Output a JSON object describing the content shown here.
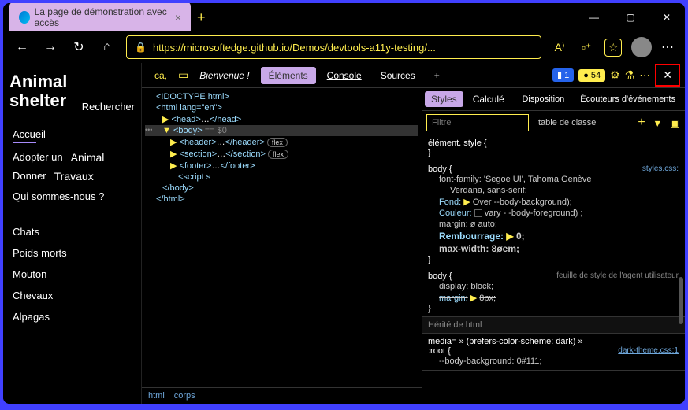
{
  "titlebar": {
    "tab_title": "La page de démonstration avec accès",
    "tab_close": "×",
    "new_tab": "+"
  },
  "addressbar": {
    "url": "https://microsoftedge.github.io/Demos/devtools-a11y-testing/..."
  },
  "page": {
    "title_line1": "Animal",
    "title_line2": "shelter",
    "search": "Rechercher",
    "nav": {
      "home": "Accueil",
      "adopt_a": "Adopter un",
      "adopt_b": "Animal",
      "donate_a": "Donner",
      "donate_b": "Travaux",
      "about": "Qui sommes-nous ?"
    },
    "animals": [
      "Chats",
      "Poids morts",
      "Mouton",
      "Chevaux",
      "Alpagas"
    ]
  },
  "devtools": {
    "tabs": {
      "ca": "ca,",
      "welcome": "Bienvenue !",
      "elements": "Éléments",
      "console": "Console",
      "sources": "Sources",
      "plus": "+"
    },
    "badges": {
      "issues": "1",
      "warnings": "54"
    },
    "close": "✕",
    "elements_tree": {
      "l1": "<!DOCTYPE html>",
      "l2": "<html lang=\"en\">",
      "l3_open": "<head>",
      "l3_mid": "…",
      "l3_close": "</head>",
      "l4": "<body>",
      "l4_eq": " == $0",
      "l5_open": "<header>",
      "l5_mid": "…",
      "l5_close": "</header>",
      "l5_flex": "flex",
      "l6_open": "<section>",
      "l6_mid": "…",
      "l6_close": "</section>",
      "l6_flex": "flex",
      "l7_open": "<footer>",
      "l7_mid": "…",
      "l7_close": "</footer>",
      "l8": "<script s",
      "l9": "</body>",
      "l10": "</html>"
    },
    "crumbs": {
      "a": "html",
      "b": "corps"
    },
    "styles": {
      "tabs": {
        "styles": "Styles",
        "computed": "Calculé",
        "layout": "Disposition",
        "listeners": "Écouteurs d'événements"
      },
      "filter_placeholder": "Filtre",
      "hov": "table de classe",
      "plus": "+",
      "rule1": {
        "sel": "élément. style {",
        "close": "}"
      },
      "rule2": {
        "sel": "body {",
        "src": "styles.css:",
        "p1": "font-family: 'Segoe            UI',    Tahoma    Genève",
        "p1b": "Verdana, sans-serif;",
        "p2n": "Fond:",
        "p2v": "Over --body-background);",
        "p3n": "Couleur:",
        "p3v": "vary - -body-foreground) ;",
        "p4": "margin: ø auto;",
        "p5n": "Rembourrage:",
        "p5v": "0;",
        "p6": "max-width: 8øem;",
        "close": "}"
      },
      "rule3": {
        "sel": "body {",
        "src": "feuille de style de l'agent utilisateur",
        "p1": "display: block;",
        "p2n": "margin:",
        "p2v": "8px;",
        "close": "}"
      },
      "inherit": "Hérité de html",
      "rule4": {
        "sel": "media= » (prefers-color-scheme: dark) »",
        "sel2": ":root {",
        "src": "dark-theme.css:1",
        "p1": "--body-background: 0#111;"
      }
    }
  }
}
